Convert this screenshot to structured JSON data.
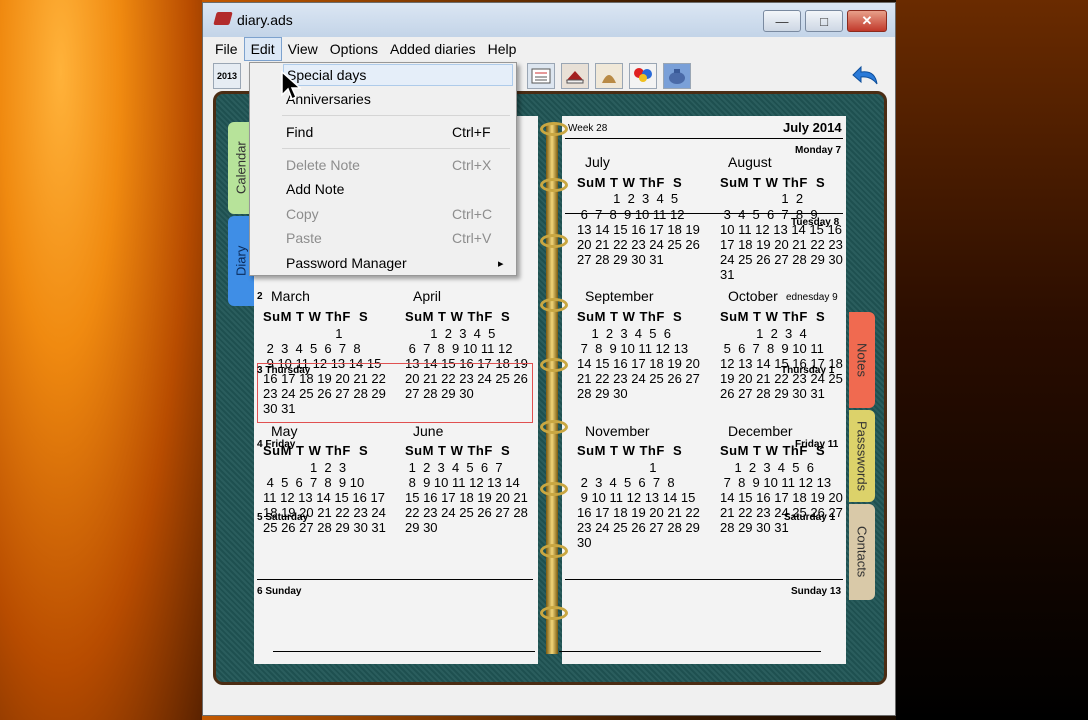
{
  "window": {
    "title": "diary.ads",
    "minimize": "―",
    "maximize": "□",
    "close": "✕"
  },
  "menu": {
    "items": [
      "File",
      "Edit",
      "View",
      "Options",
      "Added diaries",
      "Help"
    ]
  },
  "toolbar": {
    "year_label": "2013"
  },
  "edit_menu": {
    "items": [
      {
        "label": "Special days",
        "shortcut": "",
        "disabled": false
      },
      {
        "label": "Anniversaries",
        "shortcut": "",
        "disabled": false
      },
      {
        "label": "Find",
        "shortcut": "Ctrl+F",
        "disabled": false
      },
      {
        "label": "Delete Note",
        "shortcut": "Ctrl+X",
        "disabled": true
      },
      {
        "label": "Add Note",
        "shortcut": "",
        "disabled": false
      },
      {
        "label": "Copy",
        "shortcut": "Ctrl+C",
        "disabled": true
      },
      {
        "label": "Paste",
        "shortcut": "Ctrl+V",
        "disabled": true
      },
      {
        "label": "Password Manager",
        "shortcut": "",
        "disabled": false
      }
    ],
    "submenu_arrow": "▸"
  },
  "tabs": {
    "calendar": "Calendar",
    "diary": "Diary",
    "notes": "Notes",
    "passwords": "Passswords",
    "contacts": "Contacts"
  },
  "diary": {
    "week": "Week 28",
    "month_year": "July 2014",
    "day_labels": {
      "monday": "Monday 7",
      "tuesday": "Tuesday 8",
      "thursday_left": "3 Thursday",
      "thursday_right": "Thursday 1",
      "friday_left": "4 Friday",
      "friday_right": "Friday 11",
      "saturday_left": "5 Saturday",
      "saturday_right": "Saturday 1",
      "sunday_left": "6 Sunday",
      "sunday_right": "Sunday 13",
      "wednesday_right": "ednesday 9",
      "two": "2"
    }
  },
  "calendar_header": "SuM T W ThF  S",
  "months": {
    "march": {
      "name": "March",
      "rows": [
        "                    1",
        " 2  3  4  5  6  7  8",
        " 9 10 11 12 13 14 15",
        "16 17 18 19 20 21 22",
        "23 24 25 26 27 28 29",
        "30 31"
      ]
    },
    "april": {
      "name": "April",
      "rows": [
        "       1  2  3  4  5",
        " 6  7  8  9 10 11 12",
        "13 14 15 16 17 18 19",
        "20 21 22 23 24 25 26",
        "27 28 29 30"
      ]
    },
    "may": {
      "name": "May",
      "rows": [
        "             1  2  3",
        " 4  5  6  7  8  9 10",
        "11 12 13 14 15 16 17",
        "18 19 20 21 22 23 24",
        "25 26 27 28 29 30 31"
      ]
    },
    "june": {
      "name": "June",
      "rows": [
        " 1  2  3  4  5  6  7",
        " 8  9 10 11 12 13 14",
        "15 16 17 18 19 20 21",
        "22 23 24 25 26 27 28",
        "29 30"
      ]
    },
    "july": {
      "name": "July",
      "rows": [
        "          1  2  3  4  5",
        " 6  7  8  9 10 11 12",
        "13 14 15 16 17 18 19",
        "20 21 22 23 24 25 26",
        "27 28 29 30 31"
      ]
    },
    "august": {
      "name": "August",
      "rows": [
        "                 1  2",
        " 3  4  5  6  7  8  9",
        "10 11 12 13 14 15 16",
        "17 18 19 20 21 22 23",
        "24 25 26 27 28 29 30",
        "31"
      ]
    },
    "september": {
      "name": "September",
      "rows": [
        "    1  2  3  4  5  6",
        " 7  8  9 10 11 12 13",
        "14 15 16 17 18 19 20",
        "21 22 23 24 25 26 27",
        "28 29 30"
      ]
    },
    "october": {
      "name": "October",
      "rows": [
        "          1  2  3  4",
        " 5  6  7  8  9 10 11",
        "12 13 14 15 16 17 18",
        "19 20 21 22 23 24 25",
        "26 27 28 29 30 31"
      ]
    },
    "november": {
      "name": "November",
      "rows": [
        "                    1",
        " 2  3  4  5  6  7  8",
        " 9 10 11 12 13 14 15",
        "16 17 18 19 20 21 22",
        "23 24 25 26 27 28 29",
        "30"
      ]
    },
    "december": {
      "name": "December",
      "rows": [
        "    1  2  3  4  5  6",
        " 7  8  9 10 11 12 13",
        "14 15 16 17 18 19 20",
        "21 22 23 24 25 26 27",
        "28 29 30 31"
      ]
    }
  }
}
